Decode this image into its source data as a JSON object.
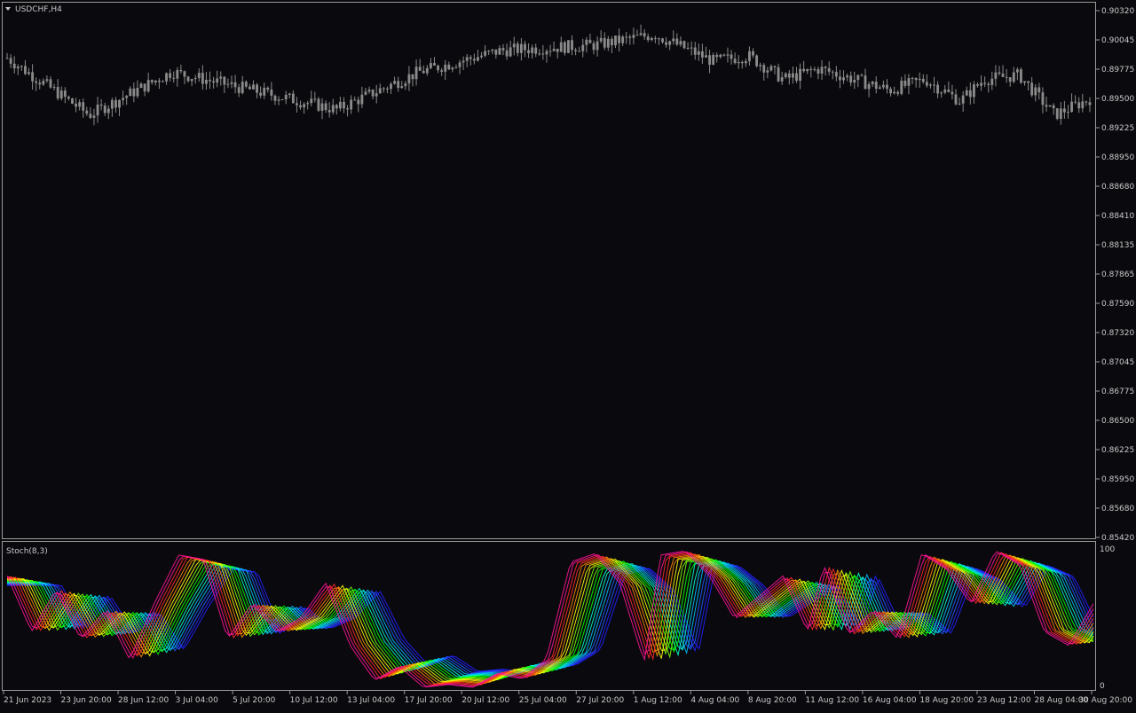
{
  "colors": {
    "background": "#0a0a0e",
    "frame": "#9a9a9a",
    "candle": "#8a8a8a",
    "text": "#c8c8c8",
    "rainbow": [
      "#ff1493",
      "#ff2a2a",
      "#ff8c00",
      "#ffff00",
      "#7cff00",
      "#00ff00",
      "#00ffcc",
      "#00bfff",
      "#1e5aff",
      "#2020ff"
    ]
  },
  "main_pane": {
    "symbol_label": "USDCHF,H4",
    "menu_icon": "triangle-down-icon"
  },
  "indicator_pane": {
    "label": "Stoch(8,3)",
    "scale_labels": [
      "100",
      "0"
    ]
  },
  "chart_data": [
    {
      "type": "candlestick",
      "ylim": [
        0.8542,
        0.9032
      ],
      "y_ticks": [
        "0.90320",
        "0.90045",
        "0.89775",
        "0.89500",
        "0.89225",
        "0.88950",
        "0.88680",
        "0.88410",
        "0.88135",
        "0.87865",
        "0.87590",
        "0.87320",
        "0.87045",
        "0.86775",
        "0.86500",
        "0.86225",
        "0.85950",
        "0.85680",
        "0.85420"
      ],
      "x_labels": [
        "21 Jun 2023",
        "23 Jun 20:00",
        "28 Jun 12:00",
        "3 Jul 04:00",
        "5 Jul 20:00",
        "10 Jul 12:00",
        "13 Jul 04:00",
        "17 Jul 20:00",
        "20 Jul 12:00",
        "25 Jul 04:00",
        "27 Jul 20:00",
        "1 Aug 12:00",
        "4 Aug 04:00",
        "8 Aug 20:00",
        "11 Aug 12:00",
        "16 Aug 04:00",
        "18 Aug 20:00",
        "23 Aug 12:00",
        "28 Aug 04:00",
        "30 Aug 20:00"
      ],
      "close_path": [
        [
          0,
          0.8988
        ],
        [
          7,
          0.8935
        ],
        [
          14,
          0.8975
        ],
        [
          20,
          0.896
        ],
        [
          28,
          0.894
        ],
        [
          35,
          0.8975
        ],
        [
          42,
          0.8995
        ],
        [
          50,
          0.9
        ],
        [
          55,
          0.901
        ],
        [
          60,
          0.8985
        ],
        [
          63,
          0.899
        ],
        [
          66,
          0.8968
        ],
        [
          69,
          0.8978
        ],
        [
          72,
          0.8968
        ],
        [
          75,
          0.8958
        ],
        [
          78,
          0.8968
        ],
        [
          81,
          0.8948
        ],
        [
          83,
          0.8968
        ],
        [
          86,
          0.8972
        ],
        [
          89,
          0.8935
        ],
        [
          92,
          0.895
        ]
      ]
    },
    {
      "type": "line",
      "ylim": [
        0,
        100
      ],
      "series_count": 20,
      "points": [
        [
          0,
          80
        ],
        [
          3,
          40
        ],
        [
          6,
          70
        ],
        [
          9,
          35
        ],
        [
          12,
          55
        ],
        [
          15,
          20
        ],
        [
          18,
          60
        ],
        [
          21,
          95
        ],
        [
          24,
          92
        ],
        [
          27,
          35
        ],
        [
          30,
          60
        ],
        [
          33,
          40
        ],
        [
          36,
          50
        ],
        [
          39,
          75
        ],
        [
          42,
          30
        ],
        [
          45,
          5
        ],
        [
          48,
          15
        ],
        [
          51,
          0
        ],
        [
          54,
          2
        ],
        [
          57,
          0
        ],
        [
          60,
          10
        ],
        [
          63,
          6
        ],
        [
          66,
          20
        ],
        [
          69,
          90
        ],
        [
          72,
          96
        ],
        [
          75,
          75
        ],
        [
          78,
          18
        ],
        [
          80,
          95
        ],
        [
          83,
          98
        ],
        [
          86,
          80
        ],
        [
          89,
          50
        ],
        [
          92,
          65
        ],
        [
          95,
          80
        ],
        [
          98,
          40
        ],
        [
          100,
          88
        ],
        [
          103,
          38
        ],
        [
          106,
          55
        ],
        [
          109,
          35
        ],
        [
          112,
          96
        ],
        [
          115,
          85
        ],
        [
          118,
          60
        ],
        [
          121,
          98
        ],
        [
          124,
          88
        ],
        [
          127,
          40
        ],
        [
          130,
          30
        ],
        [
          133,
          60
        ]
      ]
    }
  ]
}
